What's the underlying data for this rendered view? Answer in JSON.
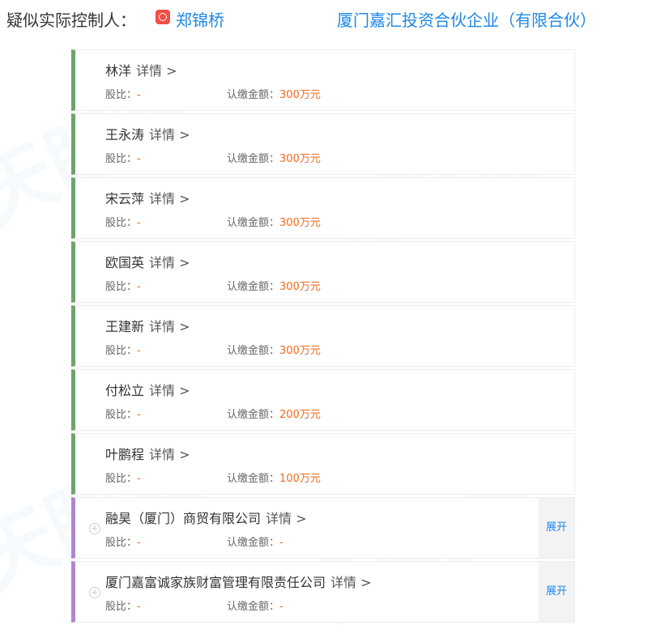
{
  "header": {
    "label": "疑似实际控制人：",
    "controller_name": "郑锦桥",
    "company": "厦门嘉汇投资合伙企业（有限合伙）"
  },
  "common": {
    "detail": "详情 >",
    "ratio_label": "股比：",
    "amount_label": "认缴金额：",
    "expand": "展开"
  },
  "shareholders": [
    {
      "name": "林洋",
      "ratio": "-",
      "amount": "300万元"
    },
    {
      "name": "王永涛",
      "ratio": "-",
      "amount": "300万元"
    },
    {
      "name": "宋云萍",
      "ratio": "-",
      "amount": "300万元"
    },
    {
      "name": "欧国英",
      "ratio": "-",
      "amount": "300万元"
    },
    {
      "name": "王建新",
      "ratio": "-",
      "amount": "300万元"
    },
    {
      "name": "付松立",
      "ratio": "-",
      "amount": "200万元"
    },
    {
      "name": "叶鹏程",
      "ratio": "-",
      "amount": "100万元"
    },
    {
      "name": "融昊（厦门）商贸有限公司",
      "ratio": "-",
      "amount": "-"
    },
    {
      "name": "厦门嘉富诚家族财富管理有限责任公司",
      "ratio": "-",
      "amount": "-"
    }
  ],
  "colors": {
    "person_bar": "#6ca46c",
    "company_bar": "#b085cf",
    "link_blue": "#1f88e5",
    "value_orange": "#f06a1e"
  }
}
